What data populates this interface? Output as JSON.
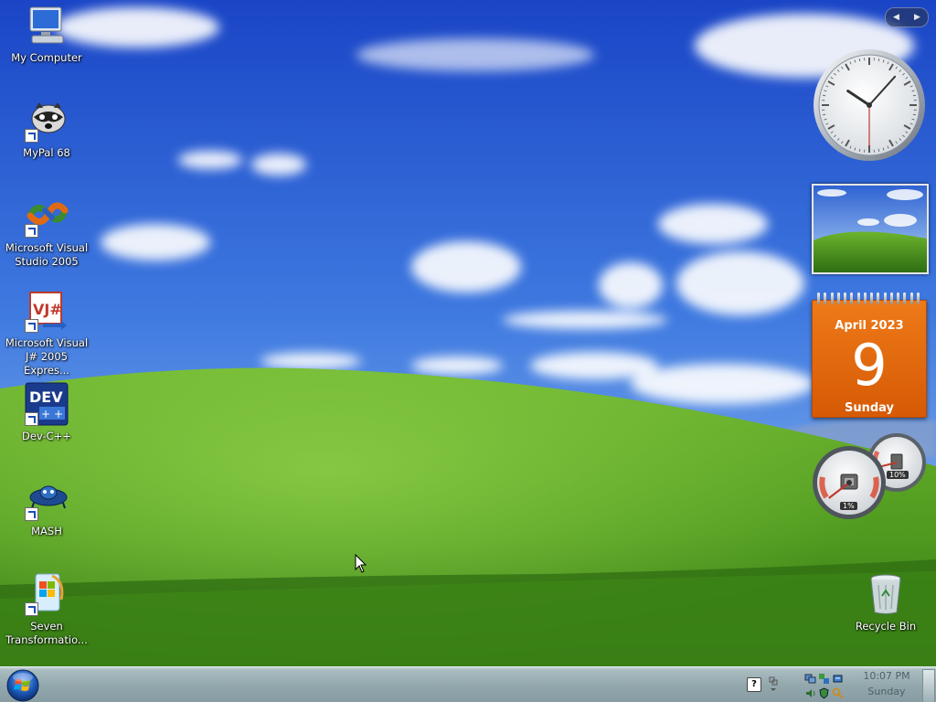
{
  "desktop": {
    "icons": [
      {
        "label": "My Computer",
        "icon": "computer-icon"
      },
      {
        "label": "MyPal 68",
        "icon": "raccoon-browser-icon"
      },
      {
        "label": "Microsoft Visual\nStudio 2005",
        "icon": "visual-studio-icon"
      },
      {
        "label": "Microsoft Visual\nJ# 2005 Expres...",
        "icon": "vjsharp-icon"
      },
      {
        "label": "Dev-C++",
        "icon": "devcpp-icon"
      },
      {
        "label": "MASH",
        "icon": "mash-icon"
      },
      {
        "label": "Seven\nTransformatio...",
        "icon": "seven-transformation-icon"
      },
      {
        "label": "Recycle Bin",
        "icon": "recycle-bin-icon"
      }
    ]
  },
  "gadgets": {
    "clock": {
      "hour": 10,
      "minute": 7,
      "second": 30
    },
    "calendar": {
      "month_year": "April 2023",
      "day": "9",
      "weekday": "Sunday"
    },
    "cpu_meter": {
      "cpu_label": "1%",
      "memory_label": "10%",
      "cpu": 0.01,
      "memory": 0.1
    }
  },
  "taskbar": {
    "time": "10:07 PM",
    "day": "Sunday",
    "help_label": "?"
  },
  "colors": {
    "sky_top": "#1f4fd0",
    "sky_bottom": "#8ab8ef",
    "grass_top": "#5ca427",
    "grass_bottom": "#2f6d12",
    "calendar_orange": "#e56d10",
    "taskbar": "#93a8ad"
  }
}
